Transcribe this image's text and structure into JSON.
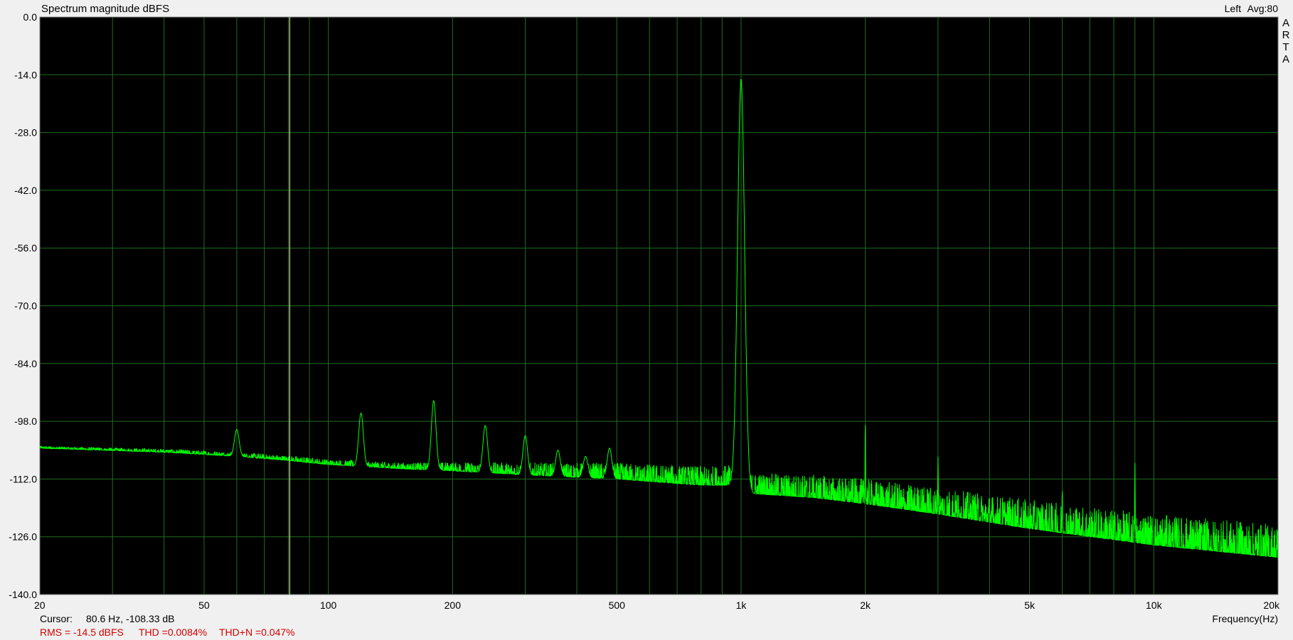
{
  "chart_data": {
    "type": "line",
    "title": "Spectrum magnitude dBFS",
    "channel_label": "Left",
    "avg_label": "Avg:80",
    "side_label": [
      "A",
      "R",
      "T",
      "A"
    ],
    "xlabel": "Frequency(Hz)",
    "ylabel": "",
    "x_scale": "log",
    "xlim": [
      20,
      20000
    ],
    "ylim": [
      -140,
      0
    ],
    "grid": true,
    "y_ticks": [
      "0.0",
      "-14.0",
      "-28.0",
      "-42.0",
      "-56.0",
      "-70.0",
      "-84.0",
      "-98.0",
      "-112.0",
      "-126.0",
      "-140.0"
    ],
    "y_tick_values": [
      0,
      -14,
      -28,
      -42,
      -56,
      -70,
      -84,
      -98,
      -112,
      -126,
      -140
    ],
    "x_ticks": [
      "20",
      "50",
      "100",
      "200",
      "500",
      "1k",
      "2k",
      "5k",
      "10k",
      "20k"
    ],
    "x_tick_values": [
      20,
      50,
      100,
      200,
      500,
      1000,
      2000,
      5000,
      10000,
      20000
    ],
    "x_minor_grid": [
      30,
      40,
      60,
      70,
      80,
      90,
      300,
      400,
      600,
      700,
      800,
      900,
      3000,
      4000,
      6000,
      7000,
      8000,
      9000
    ],
    "cursor_frequency_hz": 80.6,
    "series": [
      {
        "color": "#00ff00",
        "noise_floor": {
          "x": [
            20,
            40,
            60,
            80,
            100,
            150,
            200,
            300,
            500,
            800,
            950,
            1050,
            1500,
            2000,
            3000,
            5000,
            10000,
            20000
          ],
          "y": [
            -104.5,
            -105.5,
            -106.5,
            -107.5,
            -108.5,
            -109.5,
            -110,
            -111,
            -112,
            -113.5,
            -113.5,
            -115.5,
            -116.5,
            -118,
            -120.5,
            -124,
            -128,
            -131
          ]
        },
        "noise_spread_db": {
          "x": [
            20,
            150,
            300,
            500,
            1000,
            2000,
            5000,
            20000
          ],
          "y": [
            0.5,
            1.5,
            3,
            4,
            5,
            6,
            7,
            8
          ]
        },
        "peaks": [
          {
            "freq": 1000,
            "level": -15
          },
          {
            "freq": 60,
            "level": -100
          },
          {
            "freq": 120,
            "level": -96
          },
          {
            "freq": 180,
            "level": -93
          },
          {
            "freq": 240,
            "level": -99
          },
          {
            "freq": 300,
            "level": -101.5
          },
          {
            "freq": 360,
            "level": -105
          },
          {
            "freq": 420,
            "level": -106.5
          },
          {
            "freq": 480,
            "level": -104.5
          },
          {
            "freq": 2000,
            "level": -98
          },
          {
            "freq": 3000,
            "level": -106.5
          },
          {
            "freq": 6000,
            "level": -114.5
          },
          {
            "freq": 9000,
            "level": -108
          }
        ]
      }
    ]
  },
  "status": {
    "cursor_label": "Cursor:",
    "cursor_value": "80.6 Hz, -108.33 dB",
    "rms": "RMS =  -14.5 dBFS",
    "thd": "THD =0.0084%",
    "thdn": "THD+N =0.047%"
  },
  "colors": {
    "plot_background": "#000000",
    "grid": "#1f6e1f",
    "trace": "#00ff00",
    "cursor": "#ffffc0",
    "stats_text": "#d40000",
    "window_background": "#f0f0f0"
  }
}
